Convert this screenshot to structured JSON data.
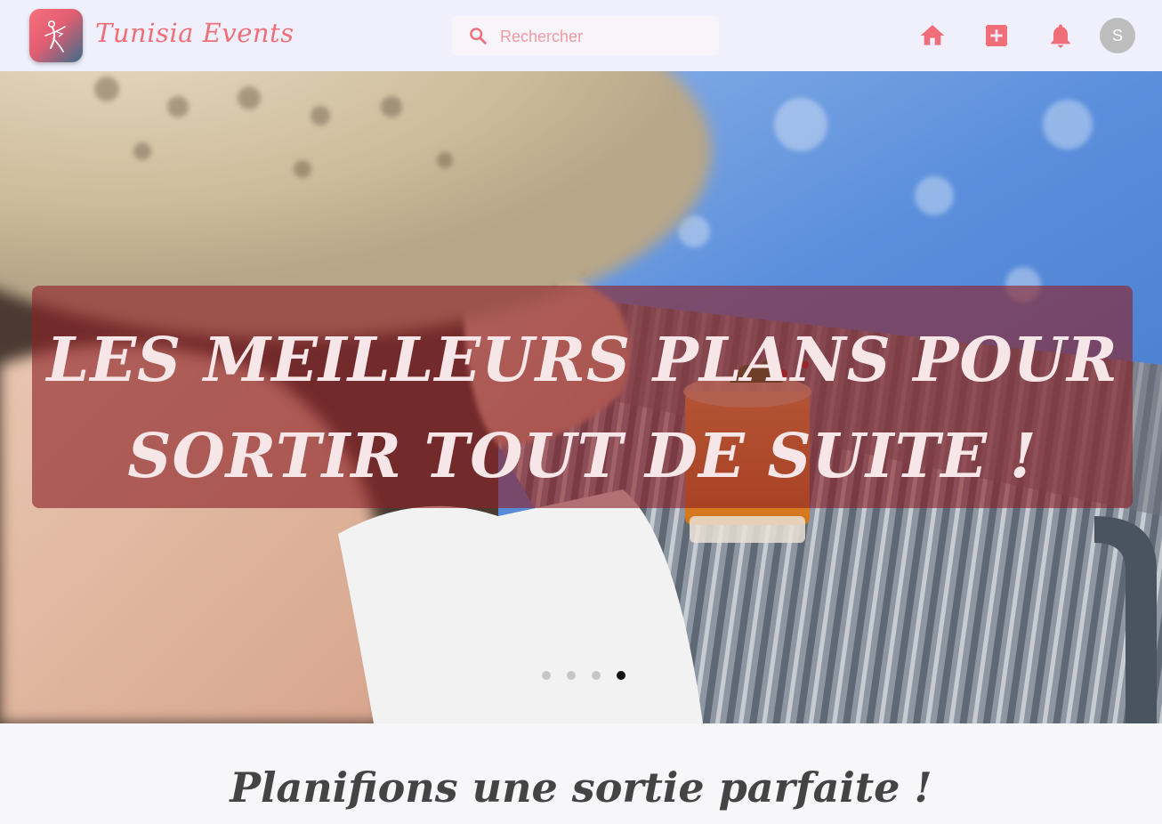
{
  "header": {
    "brand": "Tunisia Events",
    "search": {
      "placeholder": "Rechercher",
      "value": ""
    },
    "avatar_initial": "S",
    "icons": [
      "home-icon",
      "add-box-icon",
      "bell-icon"
    ],
    "accent_color": "#f06e78"
  },
  "hero": {
    "title": "LES MEILLEURS PLANS POUR SORTIR TOUT DE SUITE !",
    "slides_total": 4,
    "active_slide": 4
  },
  "section": {
    "title": "Planifions une sortie parfaite !"
  }
}
